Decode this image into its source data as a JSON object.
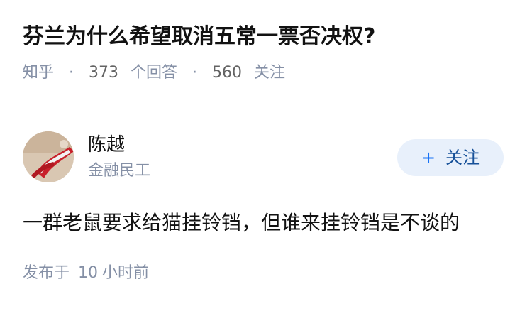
{
  "question": {
    "title": "芬兰为什么希望取消五常一票否决权?",
    "source": "知乎",
    "separator": "·",
    "answer_count": "373",
    "answer_label": "个回答",
    "follow_count": "560",
    "follow_label": "关注"
  },
  "answer": {
    "author": {
      "name": "陈越",
      "headline": "金融民工",
      "avatar_icon": "user-avatar-photo"
    },
    "follow_button": {
      "plus": "+",
      "label": "关注"
    },
    "content": "一群老鼠要求给猫挂铃铛，但谁来挂铃铛是不谈的",
    "time": {
      "prefix": "发布于",
      "value": "10",
      "suffix": "小时前"
    }
  },
  "colors": {
    "title": "#121212",
    "meta": "#8590a6",
    "follow_bg": "#e8f0fb",
    "follow_text": "#175199"
  }
}
